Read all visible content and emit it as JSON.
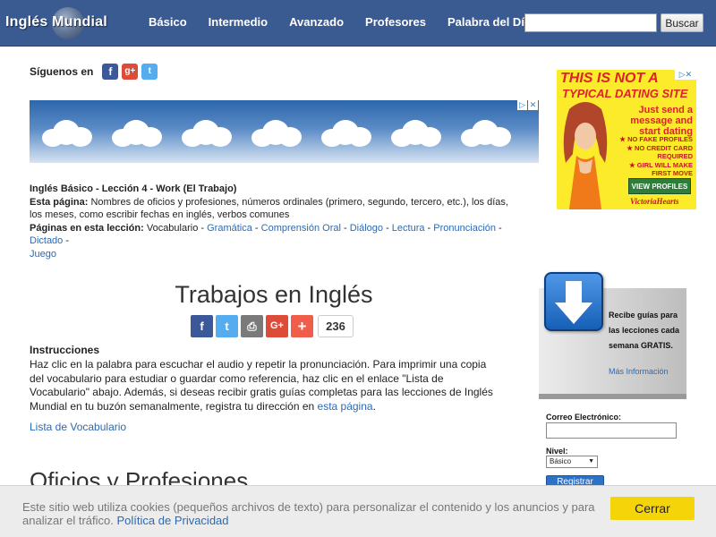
{
  "site": {
    "logo_text": "Inglés Mundial"
  },
  "nav": {
    "items": [
      "Básico",
      "Intermedio",
      "Avanzado",
      "Profesores",
      "Palabra del Día"
    ]
  },
  "search": {
    "placeholder": "",
    "button_label": "Buscar"
  },
  "follow": {
    "label": "Síguenos en",
    "icons": [
      "facebook-icon",
      "google-plus-icon",
      "twitter-icon"
    ]
  },
  "lesson": {
    "title": "Inglés Básico - Lección 4 - Work (El Trabajo)",
    "this_page_label": "Esta página:",
    "this_page_text": "Nombres de oficios y profesiones, números ordinales (primero, segundo, tercero, etc.), los días, los meses, como escribir fechas en inglés, verbos comunes",
    "pages_label": "Páginas en esta lección:",
    "pages_current": "Vocabulario",
    "pages_links": [
      "Gramática",
      "Comprensión Oral",
      "Diálogo",
      "Lectura",
      "Pronunciación",
      "Dictado",
      "Juego"
    ],
    "separator": " - "
  },
  "main": {
    "title": "Trabajos en Inglés",
    "share_count": "236",
    "instructions_title": "Instrucciones",
    "instructions_text": "Haz clic en la palabra para escuchar el audio y repetir la pronunciación. Para imprimir una copia del vocabulario para estudiar o guardar como referencia, haz clic en el enlace \"Lista de Vocabulario\" abajo. Además, si deseas recibir gratis guías completas para las lecciones de Inglés Mundial en tu buzón semanalmente, registra tu dirección en ",
    "instructions_link": "esta página",
    "instructions_end": ".",
    "vocab_link": "Lista de Vocabulario",
    "section_title": "Oficios y Profesiones"
  },
  "ad_side": {
    "headline1": "THIS IS NOT A",
    "headline2": "TYPICAL DATING SITE",
    "sub": "Just send a message and start dating",
    "bullets": [
      "★ NO FAKE PROFILES",
      "★ NO CREDIT CARD REQUIRED",
      "★ GIRL WILL MAKE FIRST MOVE"
    ],
    "button": "VIEW PROFILES",
    "brand": "VictoriaHearts"
  },
  "newsletter": {
    "text": "Recibe guías para las lecciones cada semana GRATIS.",
    "more": "Más Información",
    "email_label": "Correo Electrónico:",
    "level_label": "Nivel:",
    "level_value": "Básico",
    "register": "Registrar"
  },
  "cookie": {
    "message": "Este sitio web utiliza cookies (pequeños archivos de texto) para personalizar el contenido y los anuncios y para analizar el tráfico. ",
    "link": "Política de Privacidad",
    "close": "Cerrar"
  },
  "colors": {
    "nav_bg": "#3a5a92",
    "link": "#2c6ab3",
    "cookie_btn": "#f6d40a",
    "ad_bg": "#fbeb2a"
  }
}
